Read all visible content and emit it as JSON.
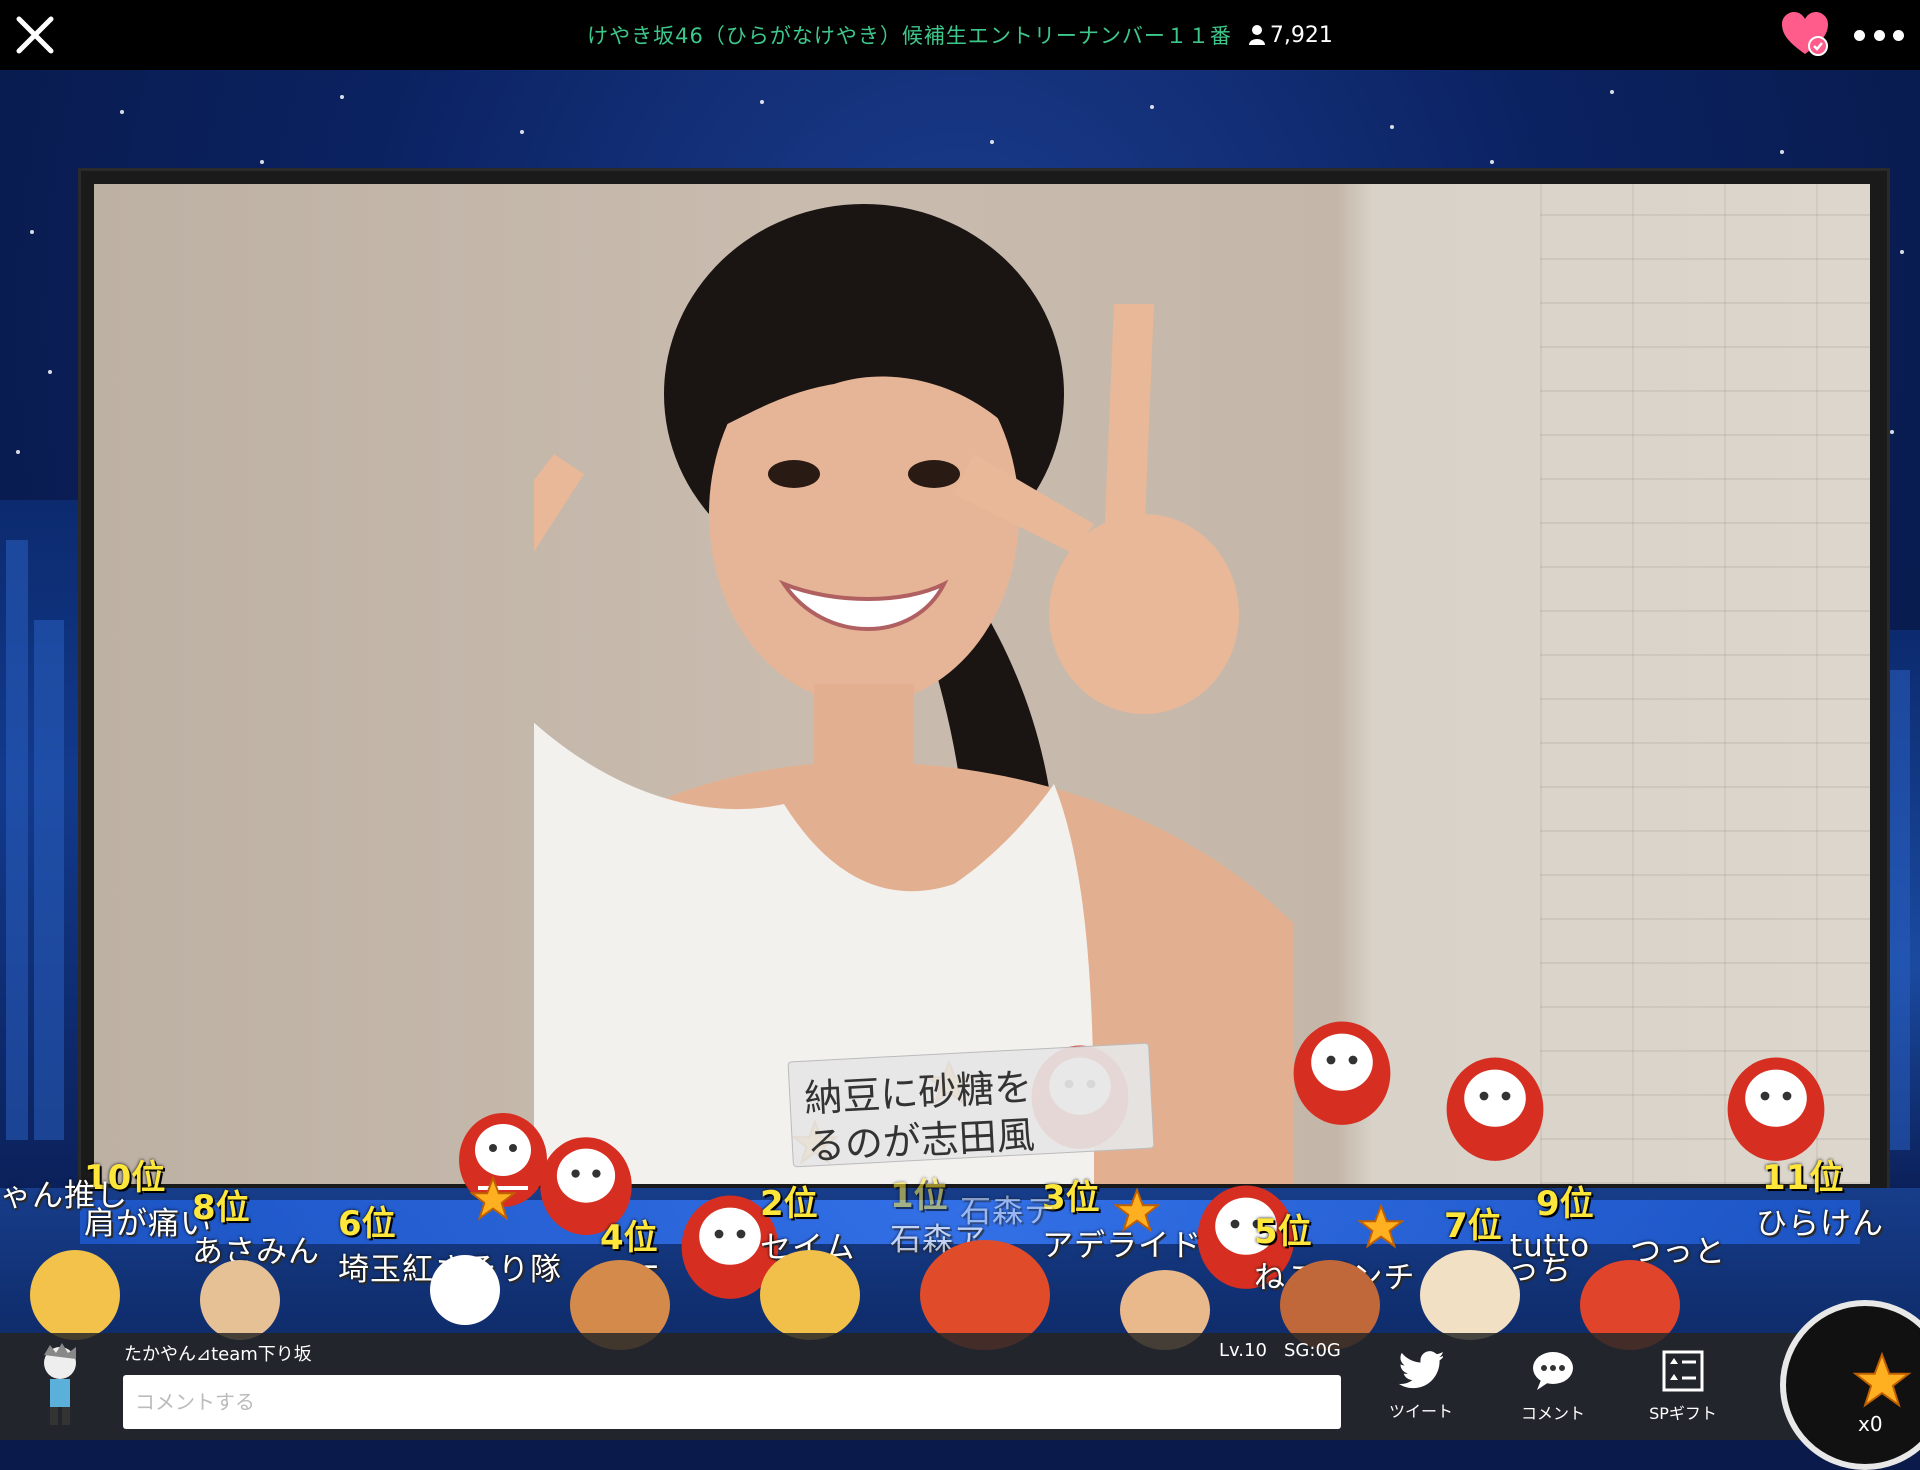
{
  "header": {
    "title": "けやき坂46（ひらがなけやき）候補生エントリーナンバー１１番",
    "viewer_count": "7,921",
    "icons": [
      "close-icon",
      "user-icon",
      "heart-check-icon",
      "more-icon"
    ]
  },
  "overlay": {
    "rankings": [
      {
        "rank": "10位",
        "name": "肩が痛い"
      },
      {
        "rank": "8位",
        "name": "あさみん"
      },
      {
        "rank": "6位",
        "name": "埼玉紅さそり隊"
      },
      {
        "rank": "4位",
        "name": "555"
      },
      {
        "rank": "2位",
        "name": "セイム"
      },
      {
        "rank": "1位",
        "name": "石森ア"
      },
      {
        "rank": "3位",
        "name": "アデライド"
      },
      {
        "rank": "5位",
        "name": "ねこパンチ"
      },
      {
        "rank": "7位",
        "name": "なわっち"
      },
      {
        "rank": "9位",
        "name": "tutto"
      },
      {
        "rank": "11位",
        "name": "ひらけん"
      }
    ],
    "extra_names": [
      "ゃん推し",
      "つっと",
      "石森テ"
    ],
    "live_comment": {
      "line1": "納豆に砂糖を",
      "line2": "るのが志田風"
    }
  },
  "footer": {
    "username": "たかやん⊿team下り坂",
    "level": "Lv.10",
    "sg": "SG:0G",
    "comment_placeholder": "コメントする",
    "buttons": {
      "tweet": "ツイート",
      "comment": "コメント",
      "sp_gift": "SPギフト"
    },
    "star_count": "x0"
  }
}
